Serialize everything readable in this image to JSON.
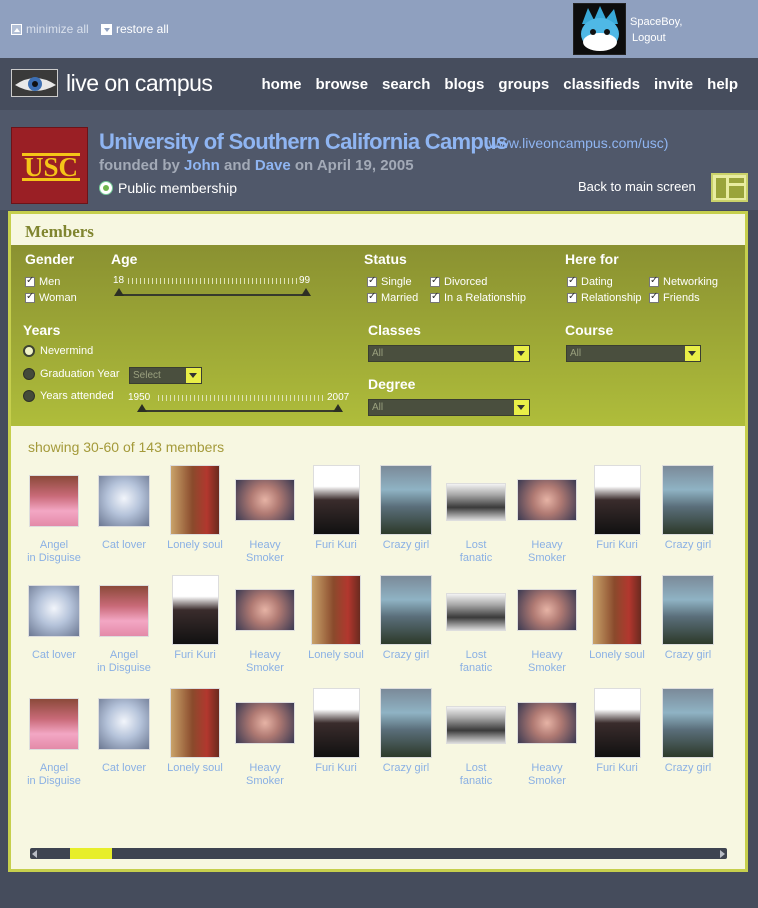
{
  "topbar": {
    "minimize_label": "minimize all",
    "restore_label": "restore all",
    "username": "SpaceBoy,",
    "logout_label": "Logout"
  },
  "brand": {
    "name": "live on campus"
  },
  "nav": [
    "home",
    "browse",
    "search",
    "blogs",
    "groups",
    "classifieds",
    "invite",
    "help"
  ],
  "campus": {
    "logo_text": "USC",
    "title": "University of Southern California Campus",
    "url": "(www.liveoncampus.com/usc)",
    "founded_prefix": "founded by",
    "founder1": "John",
    "and": "and",
    "founder2": "Dave",
    "on": "on",
    "date": "April 19, 2005",
    "membership": "Public membership",
    "back_label": "Back to main screen"
  },
  "members": {
    "title": "Members",
    "filters": {
      "gender": {
        "label": "Gender",
        "options": [
          "Men",
          "Woman"
        ]
      },
      "age": {
        "label": "Age",
        "min": "18",
        "max": "99"
      },
      "status": {
        "label": "Status",
        "options": [
          "Single",
          "Married",
          "Divorced",
          "In a Relationship"
        ]
      },
      "here_for": {
        "label": "Here for",
        "options": [
          "Dating",
          "Relationship",
          "Networking",
          "Friends"
        ]
      },
      "years": {
        "label": "Years",
        "nevermind": "Nevermind",
        "graduation": "Graduation Year",
        "attended": "Years attended",
        "select_placeholder": "Select",
        "min": "1950",
        "max": "2007"
      },
      "classes": {
        "label": "Classes",
        "value": "All"
      },
      "course": {
        "label": "Course",
        "value": "All"
      },
      "degree": {
        "label": "Degree",
        "value": "All"
      }
    },
    "showing": "showing 30-60 of 143 members",
    "rows": [
      [
        "Angel in Disguise",
        "Cat lover",
        "Lonely soul",
        "Heavy Smoker",
        "Furi Kuri",
        "Crazy girl",
        "Lost fanatic",
        "Heavy Smoker",
        "Furi Kuri",
        "Crazy girl"
      ],
      [
        "Cat lover",
        "Angel in Disguise",
        "Furi Kuri",
        "Heavy Smoker",
        "Lonely soul",
        "Crazy girl",
        "Lost fanatic",
        "Heavy Smoker",
        "Lonely soul",
        "Crazy girl"
      ],
      [
        "Angel in Disguise",
        "Cat lover",
        "Lonely soul",
        "Heavy Smoker",
        "Furi Kuri",
        "Crazy girl",
        "Lost fanatic",
        "Heavy Smoker",
        "Furi Kuri",
        "Crazy girl"
      ]
    ]
  },
  "colors": {
    "accent_green": "#c6cf4d",
    "link_blue": "#8fb5f2",
    "panel_bg": "#f7f7e1"
  }
}
